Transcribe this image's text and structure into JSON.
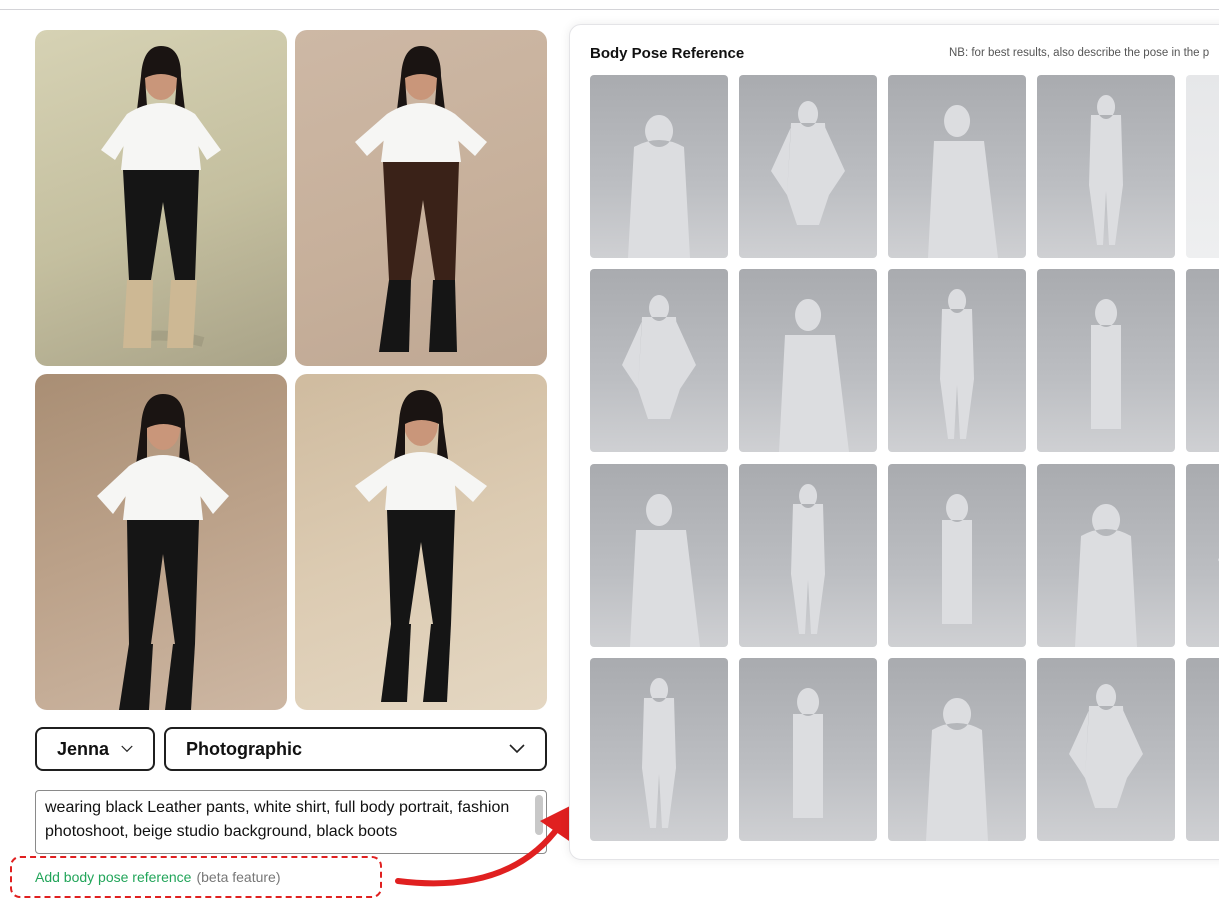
{
  "generated_images": [
    {
      "name": "result-1",
      "pants_color": "#151515",
      "boots_color": "#cdb894"
    },
    {
      "name": "result-2",
      "pants_color": "#3a2218",
      "boots_color": "#151515"
    },
    {
      "name": "result-3",
      "pants_color": "#151515",
      "boots_color": "#151515"
    },
    {
      "name": "result-4",
      "pants_color": "#151515",
      "boots_color": "#151515"
    }
  ],
  "controls": {
    "character": "Jenna",
    "style": "Photographic",
    "prompt": "wearing black Leather pants, white shirt, full body portrait, fashion photoshoot, beige studio background, black boots"
  },
  "add_pose": {
    "link_label": "Add body pose reference",
    "note": "(beta feature)"
  },
  "pose_panel": {
    "title": "Body Pose Reference",
    "note": "NB: for best results, also describe the pose in the p"
  },
  "colors": {
    "accent_green": "#22a55a",
    "highlight_red": "#e02020",
    "mannequin": "#dcdde0"
  },
  "icons": [
    "chevron-down-icon",
    "scrollbar-thumb",
    "resize-handle-icon",
    "curved-arrow-icon"
  ]
}
